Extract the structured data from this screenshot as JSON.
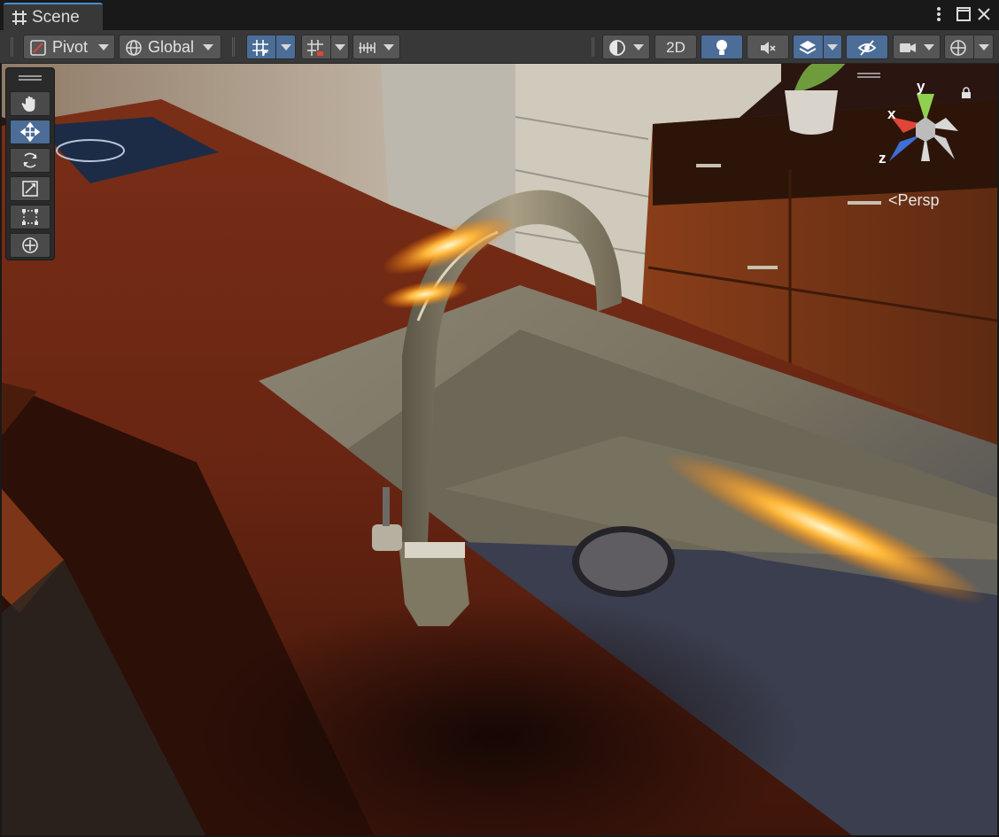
{
  "window": {
    "tab_label": "Scene",
    "tab_icon": "grid-hash-icon",
    "more_icon": "kebab-menu-icon",
    "maximize_icon": "maximize-icon",
    "close_icon": "close-icon"
  },
  "toolbar": {
    "pivot_label": "Pivot",
    "global_label": "Global",
    "mode_2d_label": "2D",
    "icons": [
      "pivot-icon",
      "globe-icon",
      "grid-snap-icon",
      "increment-snap-icon",
      "ruler-icon",
      "draw-mode-sphere-icon",
      "light-bulb-icon",
      "audio-mute-icon",
      "effects-layers-icon",
      "visibility-hidden-icon",
      "camera-icon",
      "gizmos-icon"
    ]
  },
  "tools": [
    "hand-tool-icon",
    "move-tool-icon",
    "rotate-tool-icon",
    "scale-tool-icon",
    "rect-tool-icon",
    "transform-tool-icon"
  ],
  "gizmo": {
    "y_label": "y",
    "x_label": "x",
    "z_label": "z",
    "projection_label": "Persp",
    "colors": {
      "x": "#e0453a",
      "y": "#8fd14f",
      "z": "#3e6fd6"
    }
  }
}
